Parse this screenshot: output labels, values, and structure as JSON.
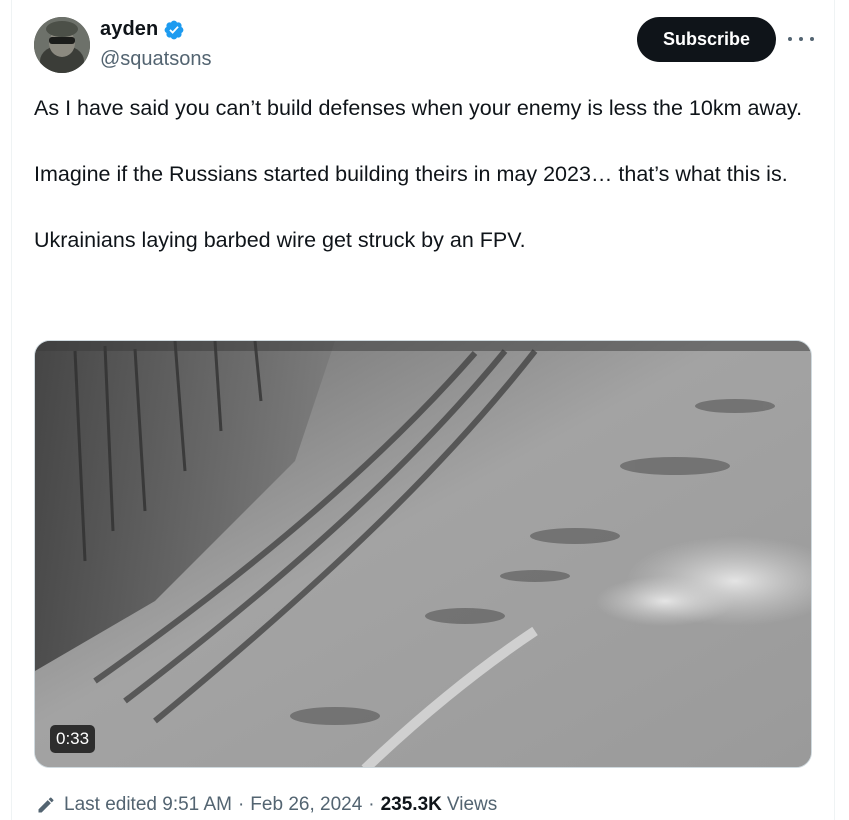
{
  "author": {
    "display_name": "ayden",
    "handle": "@squatsons",
    "verified": true,
    "verified_color": "#1d9bf0",
    "avatar_icon": "avatar-image"
  },
  "actions": {
    "subscribe_label": "Subscribe",
    "more_icon": "more-options-icon"
  },
  "tweet": {
    "paragraphs": [
      "As I have said you can’t build defenses when your enemy is less the 10km away.",
      "Imagine if the Russians started building theirs in may 2023… that’s what this is.",
      "Ukrainians laying barbed wire get struck by an FPV."
    ]
  },
  "media": {
    "type": "video",
    "duration": "0:33"
  },
  "meta": {
    "edit_icon": "pencil-icon",
    "edited_label": "Last edited",
    "time": "9:51 AM",
    "separator": "·",
    "date": "Feb 26, 2024",
    "views_count": "235.3K",
    "views_label": "Views"
  },
  "colors": {
    "text_primary": "#0f1419",
    "text_secondary": "#536471",
    "button_bg": "#0f1419"
  }
}
